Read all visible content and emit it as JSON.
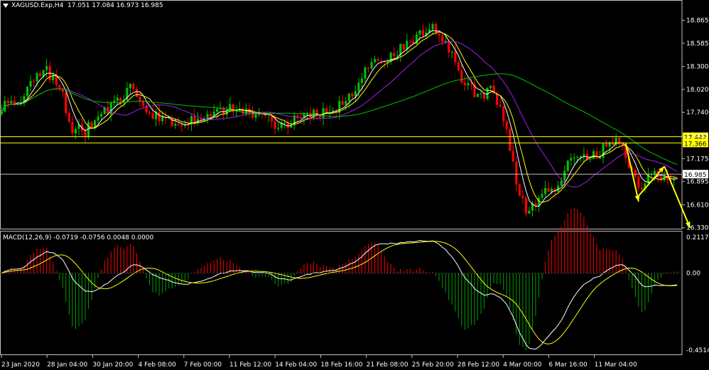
{
  "header": {
    "symbol": "XAGUSD.Exp,H4",
    "ohlc": "17.051 17.084 16.973 16.985"
  },
  "macd_header": "MACD(12,26,9) -0.0719 -0.0756 0.0048 0.0000",
  "colors": {
    "background": "#000000",
    "bull_candle": "#00c000",
    "bear_candle": "#ff0000",
    "ma_fast": "#ffffff",
    "ma_mid": "#ffff00",
    "ma_slow": "#a020f0",
    "ma_long": "#00c000",
    "level_line": "#ffff00",
    "arrow": "#ffff00",
    "macd_pos": "#ff0000",
    "macd_neg": "#00a000",
    "macd_line": "#ffffff",
    "signal_line": "#ffff00"
  },
  "chart_data": [
    {
      "type": "candlestick",
      "name": "price",
      "yticks": [
        "18.865",
        "18.585",
        "18.300",
        "18.020",
        "17.740",
        "17.455",
        "17.175",
        "16.895",
        "16.610",
        "16.330"
      ],
      "ylim": [
        16.31,
        19.0
      ],
      "xticks": [
        "23 Jan 2020",
        "28 Jan 04:00",
        "30 Jan 20:00",
        "4 Feb 08:00",
        "7 Feb 00:00",
        "11 Feb 12:00",
        "14 Feb 04:00",
        "18 Feb 16:00",
        "21 Feb 08:00",
        "25 Feb 20:00",
        "28 Feb 12:00",
        "4 Mar 00:00",
        "6 Mar 16:00",
        "11 Mar 04:00"
      ],
      "price_profile": [
        [
          0,
          17.8
        ],
        [
          6,
          17.92
        ],
        [
          10,
          18.12
        ],
        [
          14,
          18.25
        ],
        [
          18,
          18.05
        ],
        [
          22,
          17.55
        ],
        [
          26,
          17.5
        ],
        [
          30,
          17.7
        ],
        [
          36,
          17.85
        ],
        [
          40,
          18.02
        ],
        [
          44,
          17.8
        ],
        [
          48,
          17.68
        ],
        [
          52,
          17.62
        ],
        [
          56,
          17.6
        ],
        [
          60,
          17.68
        ],
        [
          64,
          17.72
        ],
        [
          70,
          17.78
        ],
        [
          76,
          17.74
        ],
        [
          82,
          17.68
        ],
        [
          86,
          17.58
        ],
        [
          90,
          17.62
        ],
        [
          94,
          17.7
        ],
        [
          98,
          17.72
        ],
        [
          102,
          17.78
        ],
        [
          106,
          17.82
        ],
        [
          110,
          18.05
        ],
        [
          114,
          18.3
        ],
        [
          118,
          18.38
        ],
        [
          122,
          18.45
        ],
        [
          126,
          18.58
        ],
        [
          130,
          18.7
        ],
        [
          134,
          18.8
        ],
        [
          137,
          18.62
        ],
        [
          140,
          18.42
        ],
        [
          143,
          18.12
        ],
        [
          146,
          18.02
        ],
        [
          149,
          17.92
        ],
        [
          152,
          18.0
        ],
        [
          155,
          17.8
        ],
        [
          158,
          17.3
        ],
        [
          161,
          16.7
        ],
        [
          164,
          16.5
        ],
        [
          166,
          16.62
        ],
        [
          169,
          16.75
        ],
        [
          172,
          16.82
        ],
        [
          175,
          17.05
        ],
        [
          178,
          17.2
        ],
        [
          182,
          17.18
        ],
        [
          186,
          17.25
        ],
        [
          189,
          17.42
        ],
        [
          192,
          17.38
        ],
        [
          195,
          17.1
        ],
        [
          198,
          16.82
        ],
        [
          201,
          16.95
        ],
        [
          204,
          17.0
        ],
        [
          207,
          16.92
        ],
        [
          210,
          16.985
        ]
      ],
      "ma_periods": [
        5,
        8,
        20,
        60
      ],
      "levels": [
        17.442,
        17.366,
        16.985
      ],
      "level_labels": [
        "17.442",
        "17.366",
        "16.985"
      ],
      "arrows": [
        {
          "from": [
            194,
            17.36
          ],
          "to": [
            198,
            16.65
          ]
        },
        {
          "from": [
            198,
            16.72
          ],
          "to": [
            206,
            17.08
          ]
        },
        {
          "from": [
            206,
            17.08
          ],
          "to": [
            214,
            16.33
          ]
        }
      ]
    },
    {
      "type": "bar",
      "name": "macd",
      "yticks": [
        "0.2117",
        "0.00",
        "-0.4514"
      ],
      "ylim": [
        -0.48,
        0.24
      ]
    }
  ]
}
